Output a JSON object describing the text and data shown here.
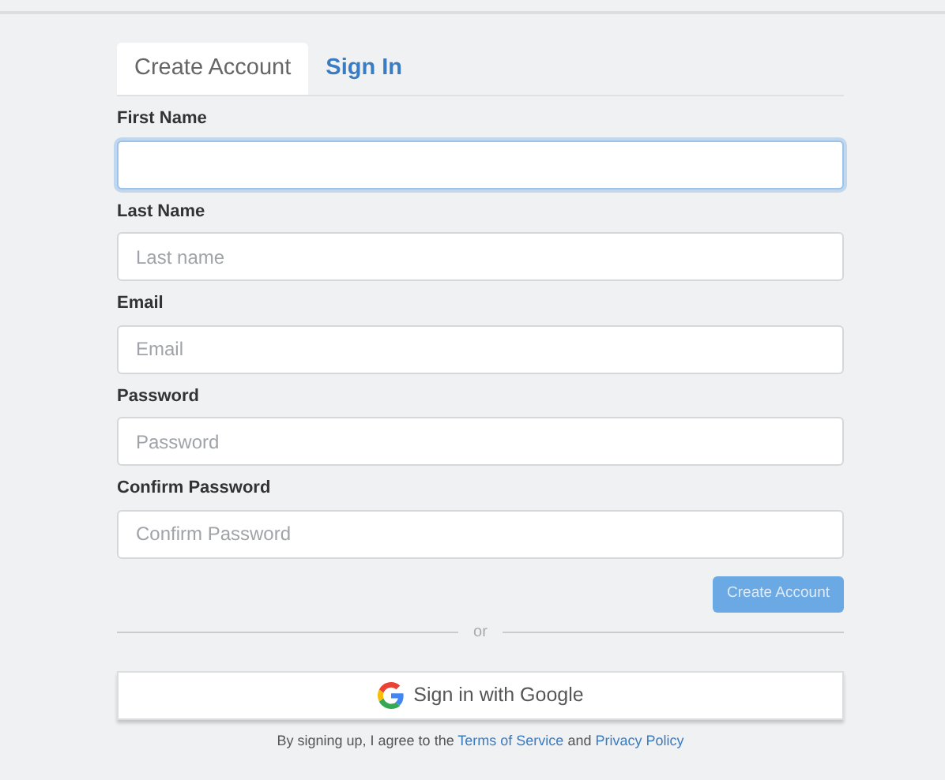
{
  "tabs": [
    {
      "label": "Create Account",
      "selected": true
    },
    {
      "label": "Sign In",
      "selected": false
    }
  ],
  "fields": [
    {
      "label": "First Name",
      "focused": true
    },
    {
      "label": "Last Name",
      "placeholder": "Last name",
      "focused": false
    },
    {
      "label": "Email",
      "placeholder": "Email",
      "focused": false
    },
    {
      "label": "Password",
      "placeholder": "Password",
      "focused": false
    },
    {
      "label": "Confirm Password",
      "placeholder": "Confirm Password",
      "focused": false
    }
  ],
  "submit": {
    "label": "Create Account",
    "disabled": true
  },
  "divider_text": "or",
  "google_button": {
    "label": "Sign in with Google"
  },
  "terms": {
    "before": "By signing up, I agree to the",
    "terms_link": "Terms of Service",
    "middle": "and",
    "privacy_link": "Privacy Policy"
  }
}
